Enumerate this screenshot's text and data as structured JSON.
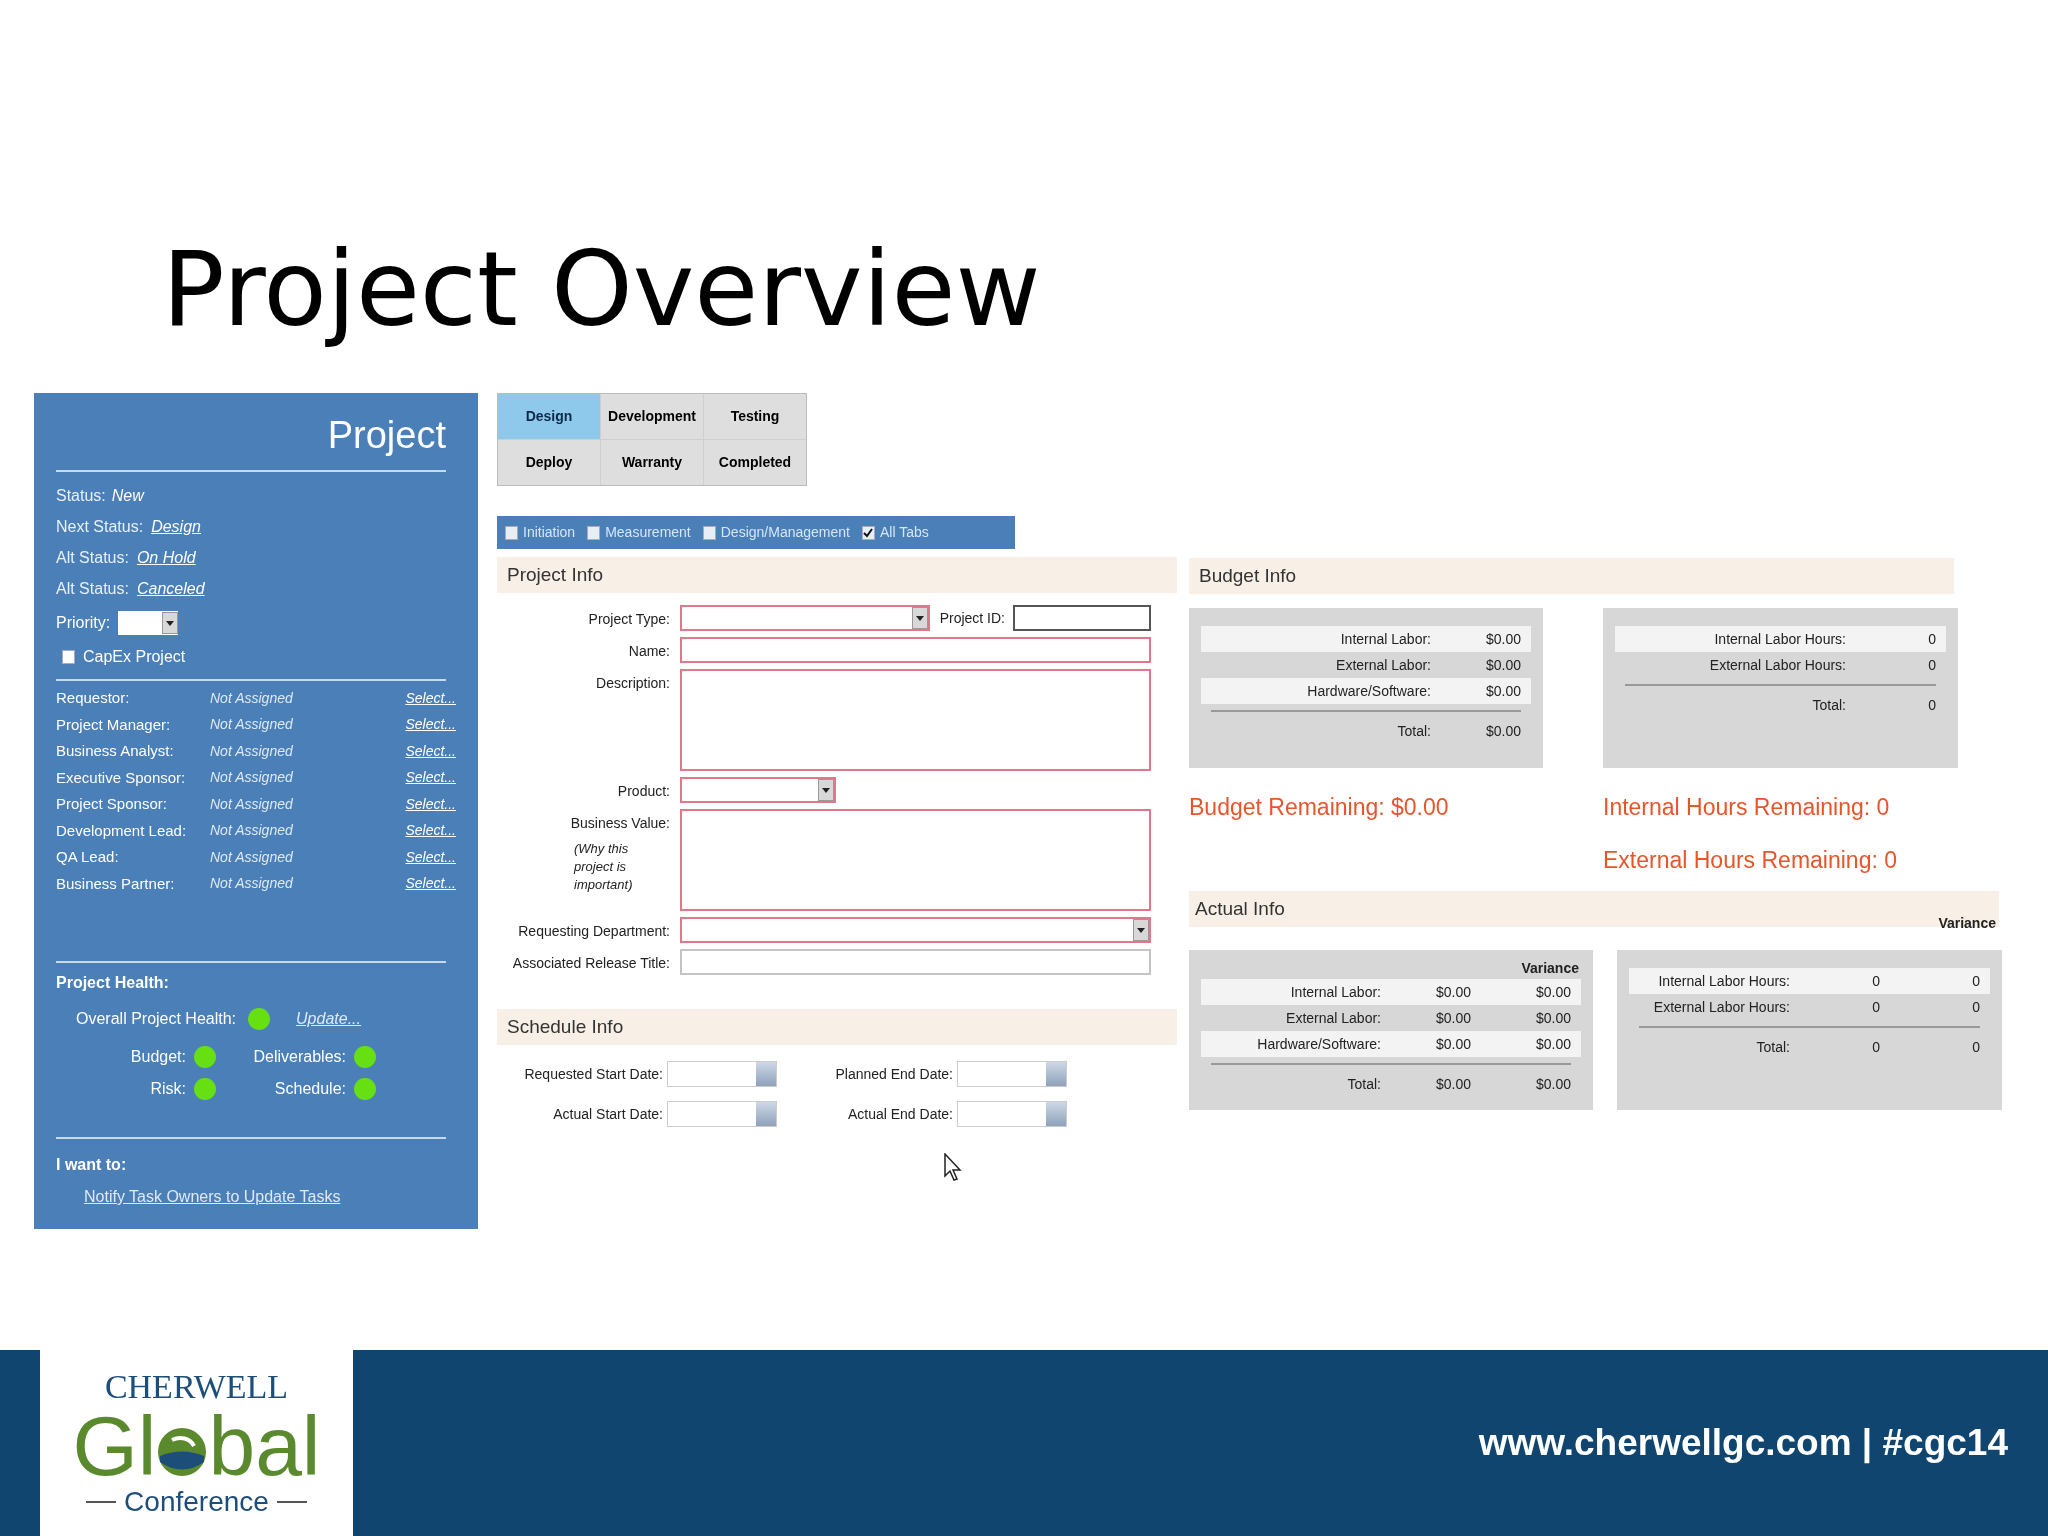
{
  "slide": {
    "title": "Project Overview"
  },
  "side_panel": {
    "title": "Project",
    "status": {
      "label": "Status:",
      "value": "New"
    },
    "status_links": [
      {
        "label": "Next Status:",
        "link": "Design"
      },
      {
        "label": "Alt Status:",
        "link": "On Hold"
      },
      {
        "label": "Alt Status:",
        "link": "Canceled"
      }
    ],
    "priority": {
      "label": "Priority:"
    },
    "capex": {
      "label": "CapEx Project",
      "checked": false
    },
    "people": [
      {
        "role": "Requestor:",
        "value": "Not Assigned",
        "action": "Select..."
      },
      {
        "role": "Project Manager:",
        "value": "Not Assigned",
        "action": "Select..."
      },
      {
        "role": "Business Analyst:",
        "value": "Not Assigned",
        "action": "Select..."
      },
      {
        "role": "Executive Sponsor:",
        "value": "Not Assigned",
        "action": "Select..."
      },
      {
        "role": "Project Sponsor:",
        "value": "Not Assigned",
        "action": "Select..."
      },
      {
        "role": "Development Lead:",
        "value": "Not Assigned",
        "action": "Select..."
      },
      {
        "role": "QA Lead:",
        "value": "Not Assigned",
        "action": "Select..."
      },
      {
        "role": "Business Partner:",
        "value": "Not Assigned",
        "action": "Select..."
      }
    ],
    "health": {
      "title": "Project Health:",
      "overall": {
        "label": "Overall Project Health:",
        "color": "#66e011",
        "link": "Update..."
      },
      "indicators": [
        {
          "label": "Budget:",
          "color": "#66e011"
        },
        {
          "label": "Deliverables:",
          "color": "#66e011"
        },
        {
          "label": "Risk:",
          "color": "#66e011"
        },
        {
          "label": "Schedule:",
          "color": "#66e011"
        }
      ]
    },
    "actions": {
      "title": "I want to:",
      "links": [
        "Notify Task Owners to Update Tasks"
      ]
    }
  },
  "stage_tabs": [
    {
      "label": "Design",
      "selected": true
    },
    {
      "label": "Development",
      "selected": false
    },
    {
      "label": "Testing",
      "selected": false
    },
    {
      "label": "Deploy",
      "selected": false
    },
    {
      "label": "Warranty",
      "selected": false
    },
    {
      "label": "Completed",
      "selected": false
    }
  ],
  "filters": [
    {
      "label": "Initiation",
      "checked": false
    },
    {
      "label": "Measurement",
      "checked": false
    },
    {
      "label": "Design/Management",
      "checked": false
    },
    {
      "label": "All Tabs",
      "checked": true
    }
  ],
  "project_info": {
    "title": "Project Info",
    "fields": [
      {
        "label": "Project Type:",
        "kind": "select",
        "required": true,
        "side_field": {
          "label": "Project ID:",
          "kind": "text",
          "required": false
        }
      },
      {
        "label": "Name:",
        "kind": "text",
        "required": true
      },
      {
        "label": "Description:",
        "kind": "textarea",
        "required": true
      },
      {
        "label": "Product:",
        "kind": "short_select",
        "required": true
      },
      {
        "label": "Business Value:",
        "note": "(Why this project is important)",
        "kind": "textarea",
        "required": true
      },
      {
        "label": "Requesting Department:",
        "kind": "select",
        "required": true
      },
      {
        "label": "Associated Release Title:",
        "kind": "text",
        "required": false
      }
    ]
  },
  "schedule_info": {
    "title": "Schedule Info",
    "dates": [
      {
        "label": "Requested Start Date:"
      },
      {
        "label": "Planned End Date:"
      },
      {
        "label": "Actual Start Date:"
      },
      {
        "label": "Actual End Date:"
      }
    ]
  },
  "budget_info": {
    "title": "Budget Info",
    "cost_table": {
      "rows": [
        {
          "label": "Internal Labor:",
          "value": "$0.00"
        },
        {
          "label": "External Labor:",
          "value": "$0.00"
        },
        {
          "label": "Hardware/Software:",
          "value": "$0.00"
        }
      ],
      "total": {
        "label": "Total:",
        "value": "$0.00"
      }
    },
    "hours_table": {
      "rows": [
        {
          "label": "Internal Labor Hours:",
          "value": "0"
        },
        {
          "label": "External Labor Hours:",
          "value": "0"
        }
      ],
      "total": {
        "label": "Total:",
        "value": "0"
      }
    },
    "remaining": [
      "Budget Remaining: $0.00",
      "Internal Hours Remaining: 0",
      "External Hours Remaining: 0"
    ]
  },
  "actual_info": {
    "title": "Actual Info",
    "header_variance": "Variance",
    "cost_table": {
      "variance_heading": "Variance",
      "rows": [
        {
          "label": "Internal Labor:",
          "value": "$0.00",
          "variance": "$0.00"
        },
        {
          "label": "External Labor:",
          "value": "$0.00",
          "variance": "$0.00"
        },
        {
          "label": "Hardware/Software:",
          "value": "$0.00",
          "variance": "$0.00"
        }
      ],
      "total": {
        "label": "Total:",
        "value": "$0.00",
        "variance": "$0.00"
      }
    },
    "hours_table": {
      "rows": [
        {
          "label": "Internal Labor Hours:",
          "value": "0",
          "variance": "0"
        },
        {
          "label": "External Labor Hours:",
          "value": "0",
          "variance": "0"
        }
      ],
      "total": {
        "label": "Total:",
        "value": "0",
        "variance": "0"
      }
    }
  },
  "footer": {
    "logo": {
      "top": "CHERWELL",
      "wordmark": [
        "Gl",
        "bal"
      ],
      "bottom": "Conference"
    },
    "text": "www.cherwellgc.com | #cgc14"
  }
}
